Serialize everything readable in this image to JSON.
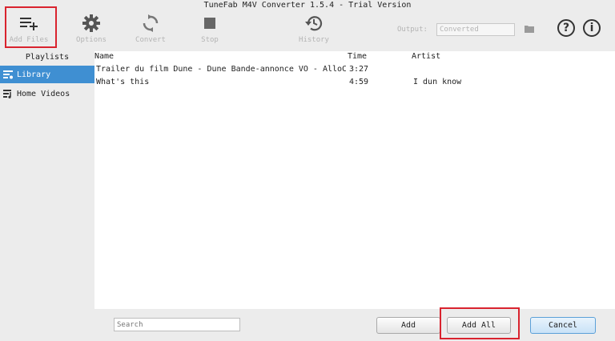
{
  "window": {
    "title": "TuneFab M4V Converter 1.5.4 - Trial Version"
  },
  "toolbar": {
    "add_files": "Add Files",
    "options": "Options",
    "convert": "Convert",
    "stop": "Stop",
    "history": "History",
    "output_label": "Output:",
    "output_value": "Converted",
    "help": "?",
    "info": "i"
  },
  "sidebar": {
    "header": "Playlists",
    "items": [
      {
        "label": "Library",
        "icon": "library-icon",
        "selected": true
      },
      {
        "label": "Home Videos",
        "icon": "home-videos-icon",
        "selected": false
      }
    ]
  },
  "table": {
    "columns": {
      "name": "Name",
      "time": "Time",
      "artist": "Artist"
    },
    "rows": [
      {
        "name": "Trailer du film Dune -  Dune Bande-annonce VO - AlloCiné",
        "time": "3:27",
        "artist": ""
      },
      {
        "name": "What's this",
        "time": "4:59",
        "artist": "I dun know"
      }
    ]
  },
  "bottom": {
    "search_placeholder": "Search",
    "add": "Add",
    "add_all": "Add All",
    "cancel": "Cancel"
  },
  "colors": {
    "accent": "#3f8fd2",
    "highlight": "#d9232e"
  }
}
